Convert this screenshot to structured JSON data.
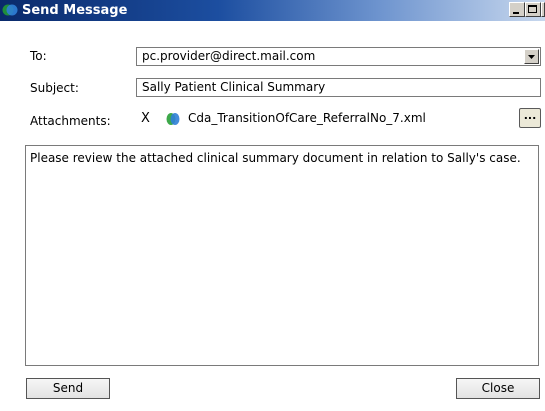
{
  "window": {
    "title": "Send Message"
  },
  "form": {
    "to_label": "To:",
    "to_value": "pc.provider@direct.mail.com",
    "subject_label": "Subject:",
    "subject_value": "Sally Patient Clinical Summary",
    "attachments_label": "Attachments:",
    "attachment_remove": "X",
    "attachment_name": "Cda_TransitionOfCare_ReferralNo_7.xml",
    "browse_label": "...",
    "body": "Please review the attached clinical summary document in relation to Sally's case."
  },
  "buttons": {
    "send": "Send",
    "close": "Close"
  },
  "icons": {
    "app": "app-icon",
    "attachment": "document-icon",
    "dropdown": "chevron-down-icon"
  }
}
